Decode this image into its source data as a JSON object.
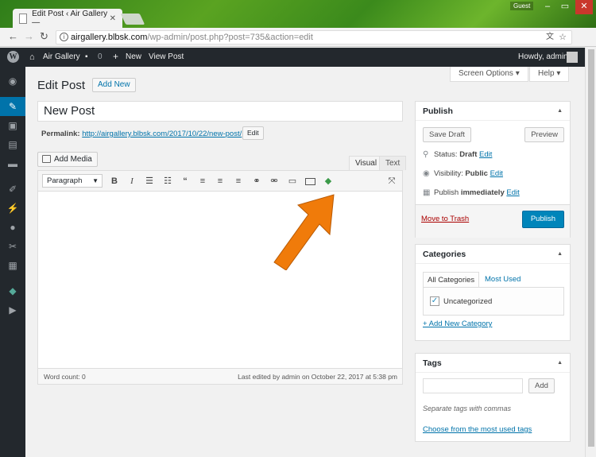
{
  "browser": {
    "tab_title": "Edit Post ‹ Air Gallery —",
    "tab_close": "✕",
    "profile": "Guest",
    "url_host": "airgallery.blbsk.com",
    "url_path": "/wp-admin/post.php?post=735&action=edit"
  },
  "adminbar": {
    "site_name": "Air Gallery",
    "comments_count": "0",
    "new_label": "New",
    "view_post": "View Post",
    "howdy": "Howdy, admin"
  },
  "screen_options": "Screen Options ▾",
  "help": "Help ▾",
  "page": {
    "heading": "Edit Post",
    "add_new": "Add New",
    "title_value": "New Post",
    "permalink_label": "Permalink:",
    "permalink_url": "http://airgallery.blbsk.com/2017/10/22/new-post/",
    "permalink_edit": "Edit"
  },
  "editor": {
    "add_media": "Add Media",
    "tab_visual": "Visual",
    "tab_text": "Text",
    "format_select": "Paragraph",
    "word_count": "Word count: 0",
    "last_edited": "Last edited by admin on October 22, 2017 at 5:38 pm"
  },
  "publish": {
    "title": "Publish",
    "save_draft": "Save Draft",
    "preview": "Preview",
    "status_label": "Status:",
    "status_value": "Draft",
    "visibility_label": "Visibility:",
    "visibility_value": "Public",
    "publish_label": "Publish",
    "publish_value": "immediately",
    "edit": "Edit",
    "move_to_trash": "Move to Trash",
    "publish_button": "Publish"
  },
  "categories": {
    "title": "Categories",
    "tab_all": "All Categories",
    "tab_used": "Most Used",
    "items": [
      {
        "label": "Uncategorized",
        "checked": true
      }
    ],
    "add_new": "+ Add New Category"
  },
  "tags": {
    "title": "Tags",
    "add_button": "Add",
    "hint": "Separate tags with commas",
    "choose": "Choose from the most used tags"
  },
  "colors": {
    "admin_bar": "#23282d",
    "accent": "#0073aa",
    "primary_button": "#0085ba",
    "arrow": "#f07b0a"
  }
}
